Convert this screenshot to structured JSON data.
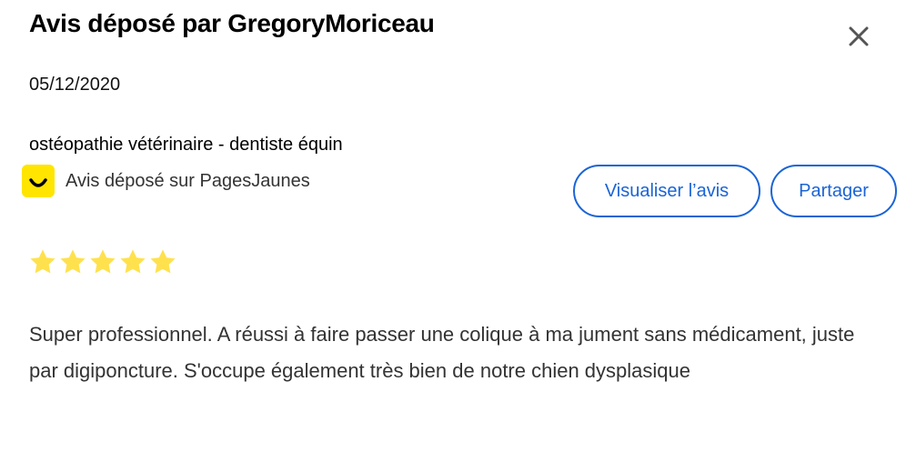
{
  "header": {
    "title": "Avis déposé par GregoryMoriceau"
  },
  "review": {
    "date": "05/12/2020",
    "business": "ostéopathie vétérinaire - dentiste équin",
    "source": "Avis déposé sur PagesJaunes",
    "rating": 5,
    "rating_max": 5,
    "text": "Super professionnel. A réussi à faire passer une colique à ma jument sans médicament, juste par digiponcture. S'occupe également très bien de notre chien dysplasique"
  },
  "actions": {
    "view_label": "Visualiser l’avis",
    "share_label": "Partager"
  },
  "icons": {
    "close": "close-icon",
    "source_logo": "pagesjaunes-logo",
    "star": "star-icon"
  },
  "colors": {
    "accent": "#1a64d6",
    "star": "#ffe14d",
    "brand_yellow": "#ffe500"
  }
}
